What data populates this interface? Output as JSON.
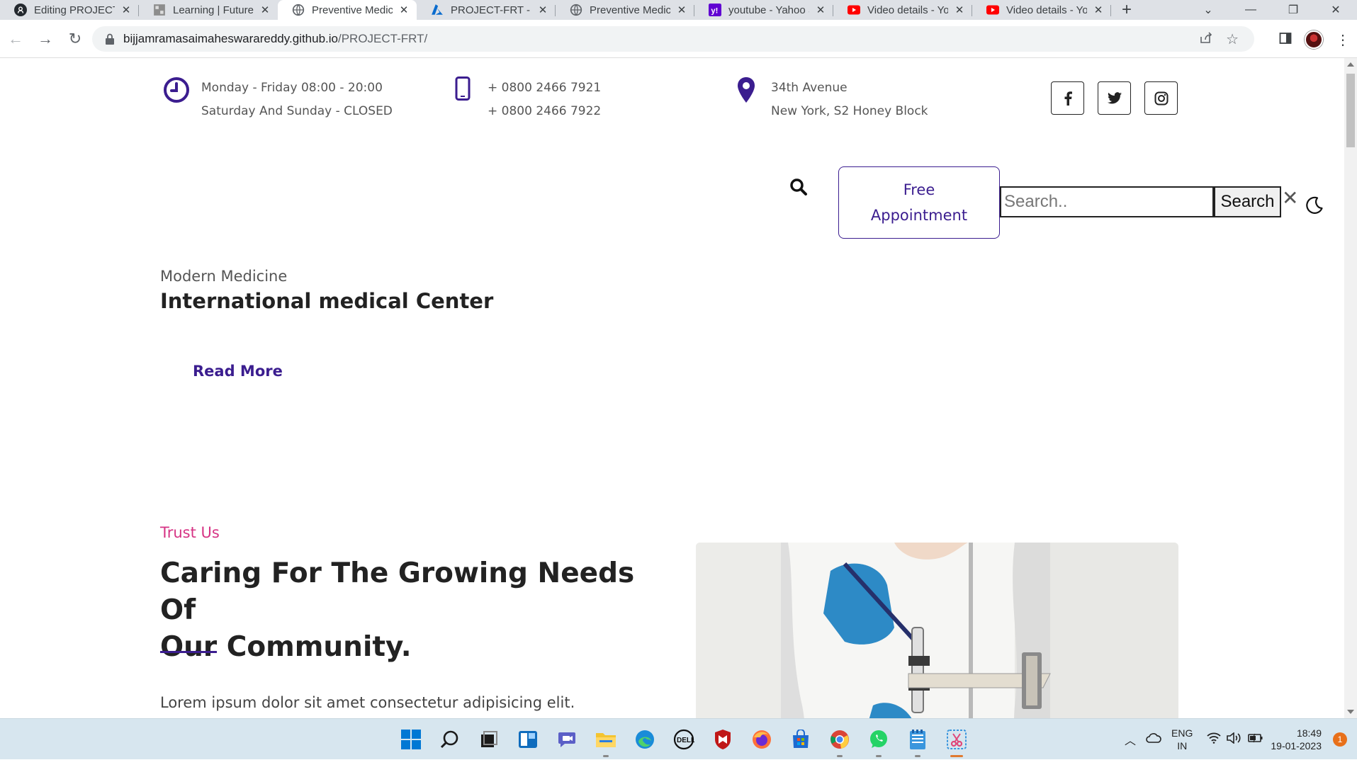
{
  "browser": {
    "tabs": [
      {
        "title": "Editing PROJECT-FRT/",
        "favicon": "github-icon",
        "active": false
      },
      {
        "title": "Learning | FutureSkills",
        "favicon": "learning-icon",
        "active": false
      },
      {
        "title": "Preventive Medicine",
        "favicon": "globe-icon",
        "active": true
      },
      {
        "title": "PROJECT-FRT - Microsoft Azure",
        "favicon": "azure-icon",
        "active": false
      },
      {
        "title": "Preventive Medicine",
        "favicon": "globe-icon",
        "active": false
      },
      {
        "title": "youtube - Yahoo Search",
        "favicon": "yahoo-icon",
        "active": false
      },
      {
        "title": "Video details - YouTube Studio",
        "favicon": "youtube-icon",
        "active": false
      },
      {
        "title": "Video details - YouTube Studio",
        "favicon": "youtube-icon",
        "active": false
      }
    ],
    "url_host": "bijjamramasaimaheswarareddy.github.io",
    "url_path": "/PROJECT-FRT/"
  },
  "topbar": {
    "hours_line1": "Monday - Friday 08:00 - 20:00",
    "hours_line2": "Saturday And Sunday - CLOSED",
    "phone_line1": "+ 0800 2466 7921",
    "phone_line2": "+ 0800 2466 7922",
    "address_line1": "34th Avenue",
    "address_line2": "New York, S2 Honey Block",
    "social": [
      "facebook-icon",
      "twitter-icon",
      "instagram-icon"
    ]
  },
  "nav": {
    "appointment_line1": "Free",
    "appointment_line2": "Appointment",
    "search_placeholder": "Search..",
    "search_button": "Search",
    "close_label": "✕"
  },
  "hero": {
    "subtitle": "Modern Medicine",
    "title": "International medical Center",
    "read_more": "Read More"
  },
  "about": {
    "eyebrow": "Trust Us",
    "heading_line1": "Caring For The Growing Needs Of",
    "heading_line2": "Our Community.",
    "body": "Lorem ipsum dolor sit amet consectetur adipisicing elit."
  },
  "taskbar": {
    "lang_line1": "ENG",
    "lang_line2": "IN",
    "time": "18:49",
    "date": "19-01-2023",
    "notifications": "1"
  },
  "colors": {
    "accent": "#3b1d8f",
    "eyebrow": "#d63384"
  }
}
